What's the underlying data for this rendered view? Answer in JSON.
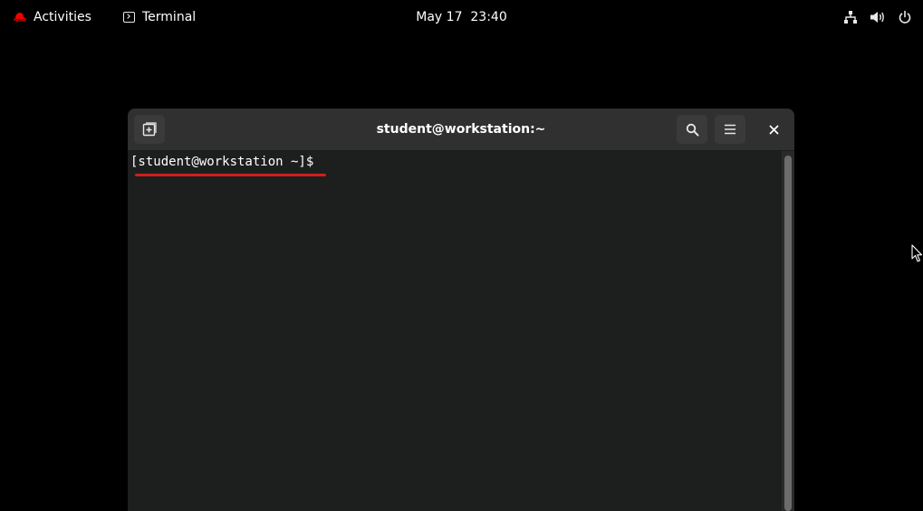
{
  "topbar": {
    "activities_label": "Activities",
    "app_name": "Terminal",
    "clock": "May 17  23:40",
    "icons": [
      "network-icon",
      "volume-icon",
      "power-icon"
    ]
  },
  "window": {
    "title": "student@workstation:~",
    "prompt": "[student@workstation ~]$ ",
    "icons": [
      "new-tab-icon",
      "search-icon",
      "hamburger-menu-icon",
      "close-icon"
    ]
  },
  "colors": {
    "desktop_bg": "#000000",
    "headerbar": "#303030",
    "terminal_bg": "#1c1f1e",
    "annotation_underline": "#d41d1d",
    "brand_red": "#ee0000"
  }
}
